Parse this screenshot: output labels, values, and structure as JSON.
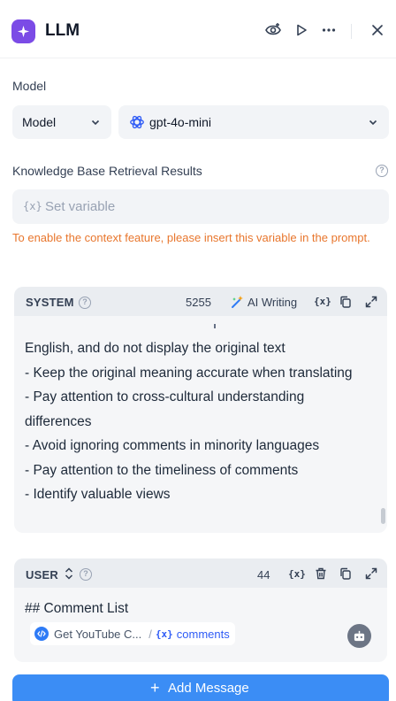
{
  "header": {
    "title": "LLM",
    "icons": [
      "sparkle-icon",
      "eye-run-icon",
      "play-icon",
      "more-icon",
      "close-icon"
    ]
  },
  "model": {
    "label": "Model",
    "type_value": "Model",
    "model_value": "gpt-4o-mini"
  },
  "knowledge": {
    "label": "Knowledge Base Retrieval Results",
    "placeholder_prefix": "{x}",
    "placeholder": "Set variable",
    "warning": "To enable the context feature, please insert this variable in the prompt."
  },
  "system": {
    "title": "SYSTEM",
    "count": "5255",
    "ai_writing": "AI Writing",
    "var_label": "{x}",
    "lines": [
      "English, and do not display the original text",
      "- Keep the original meaning accurate when translating",
      "- Pay attention to cross-cultural understanding",
      "differences",
      "- Avoid ignoring comments in minority languages",
      "- Pay attention to the timeliness of comments",
      "- Identify valuable views"
    ]
  },
  "user": {
    "title": "USER",
    "count": "44",
    "var_label": "{x}",
    "heading": "## Comment List",
    "chip_node": "Get YouTube C...",
    "chip_slash": "/",
    "chip_var_prefix": "{x}",
    "chip_var": "comments"
  },
  "footer": {
    "add_label": "Add Message",
    "plus": "+"
  },
  "colors": {
    "accent": "#3b8df5",
    "warning": "#e8762d",
    "logo": "#7b4be6"
  }
}
